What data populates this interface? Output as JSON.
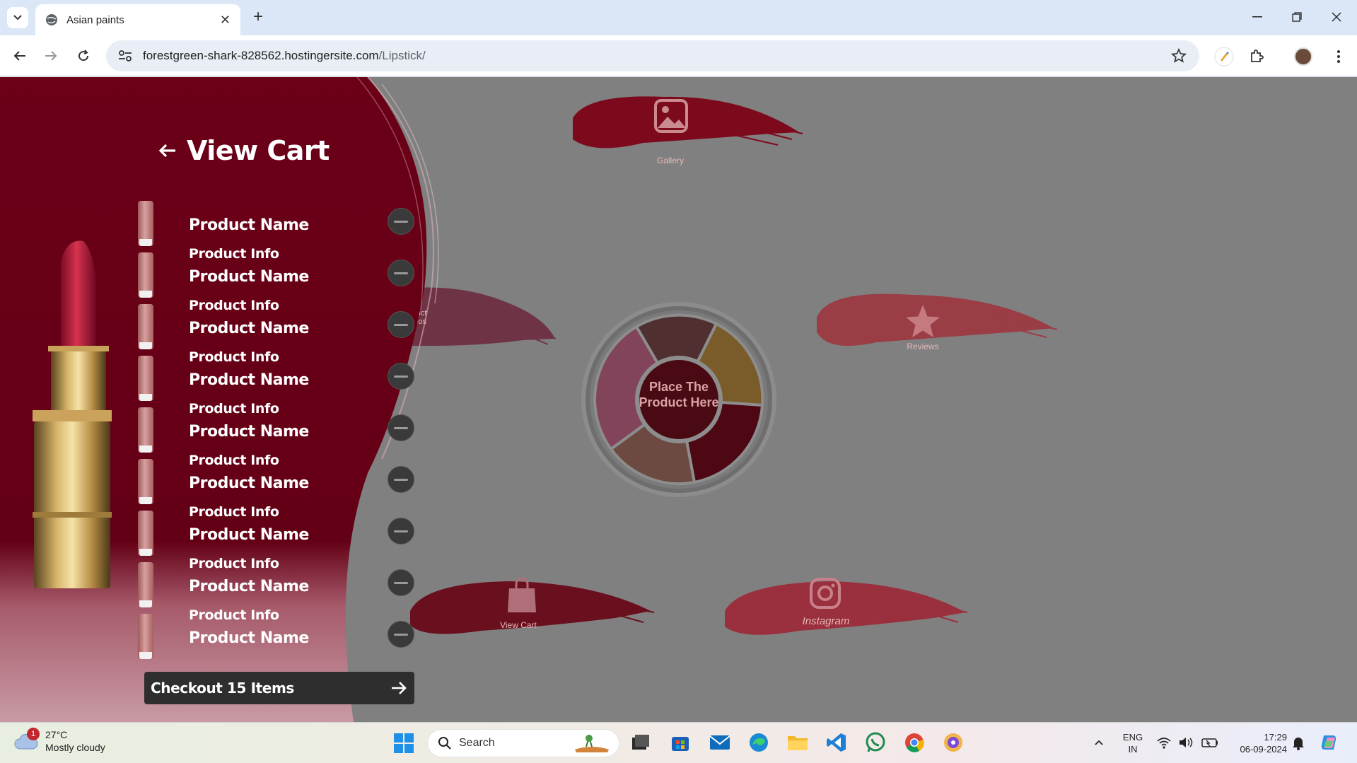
{
  "browser": {
    "tab_title": "Asian paints",
    "url_host": "forestgreen-shark-828562.hostingersite.com",
    "url_path": "/Lipstick/"
  },
  "cart": {
    "title": "View Cart",
    "items": [
      {
        "name": "Product Name",
        "info": "Product Info"
      },
      {
        "name": "Product Name",
        "info": "Product Info"
      },
      {
        "name": "Product Name",
        "info": "Product Info"
      },
      {
        "name": "Product Name",
        "info": "Product Info"
      },
      {
        "name": "Product Name",
        "info": "Product Info"
      },
      {
        "name": "Product Name",
        "info": "Product Info"
      },
      {
        "name": "Product Name",
        "info": "Product Info"
      },
      {
        "name": "Product Name",
        "info": "Product Info"
      },
      {
        "name": "Product Name"
      }
    ],
    "checkout_label": "Checkout 15 Items"
  },
  "menu": {
    "gallery": "Gallery",
    "product_videos": "oduct\nideos",
    "reviews": "Reviews",
    "view_cart": "View Cart",
    "instagram": "Instagram",
    "palette_center": "Place The Product Here"
  },
  "taskbar": {
    "temp": "27°C",
    "weather": "Mostly cloudy",
    "weather_badge": "1",
    "search": "Search",
    "lang1": "ENG",
    "lang2": "IN",
    "time": "17:29",
    "date": "06-09-2024"
  },
  "colors": {
    "cart_bg": "#6d0018",
    "brush_red": "#8e0e20",
    "brush_rose": "#b8505a",
    "overlay": "#808080"
  }
}
